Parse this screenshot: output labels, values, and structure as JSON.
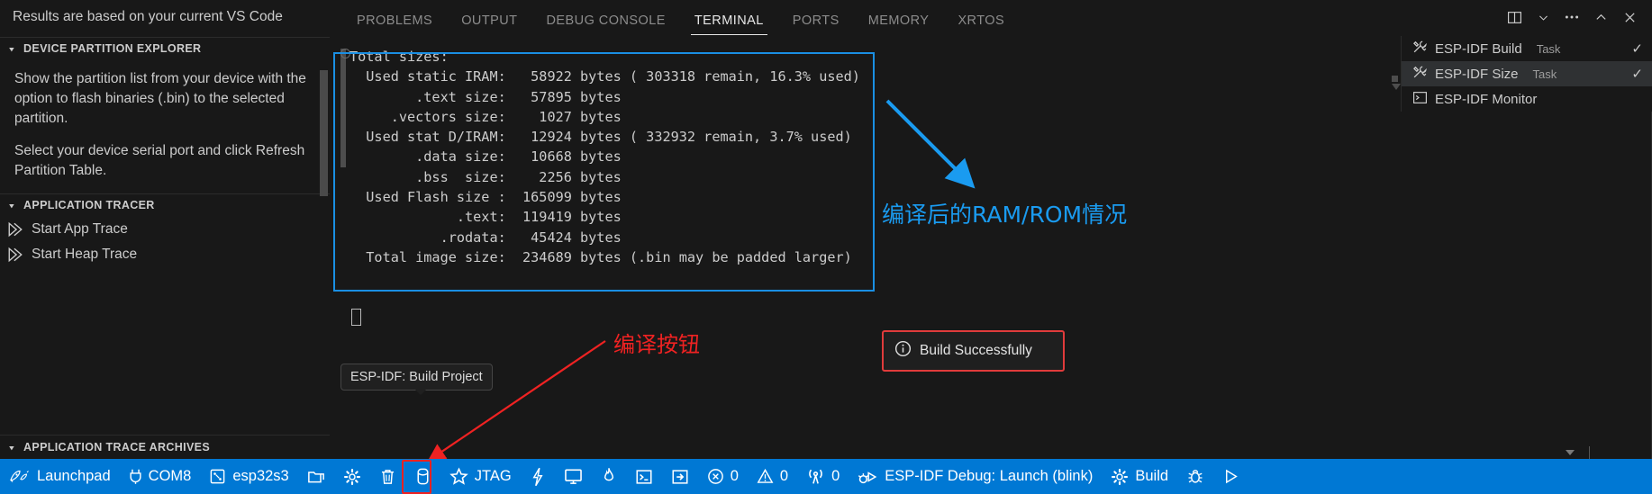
{
  "sidebar": {
    "note": "Results are based on your current VS Code",
    "sections": [
      {
        "title": "DEVICE PARTITION EXPLORER",
        "paragraphs": [
          "Show the partition list from your device with the option to flash binaries (.bin) to the selected partition.",
          "Select your device serial port and click Refresh Partition Table."
        ]
      },
      {
        "title": "APPLICATION TRACER",
        "items": [
          {
            "label": "Start App Trace",
            "icon": "double-arrow-icon"
          },
          {
            "label": "Start Heap Trace",
            "icon": "double-arrow-icon"
          }
        ]
      }
    ],
    "archives_title": "APPLICATION TRACE ARCHIVES"
  },
  "panel": {
    "tabs": [
      {
        "label": "PROBLEMS",
        "active": false
      },
      {
        "label": "OUTPUT",
        "active": false
      },
      {
        "label": "DEBUG CONSOLE",
        "active": false
      },
      {
        "label": "TERMINAL",
        "active": true
      },
      {
        "label": "PORTS",
        "active": false
      },
      {
        "label": "MEMORY",
        "active": false
      },
      {
        "label": "XRTOS",
        "active": false
      }
    ],
    "actions": [
      "split-editor-icon",
      "chevron-down-icon",
      "more-actions-icon",
      "chevron-up-icon",
      "close-icon"
    ]
  },
  "terminal": {
    "lines": [
      "Total sizes:",
      "  Used static IRAM:   58922 bytes ( 303318 remain, 16.3% used)",
      "        .text size:   57895 bytes",
      "     .vectors size:    1027 bytes",
      "  Used stat D/IRAM:   12924 bytes ( 332932 remain, 3.7% used)",
      "        .data size:   10668 bytes",
      "        .bss  size:    2256 bytes",
      "  Used Flash size :  165099 bytes",
      "             .text:  119419 bytes",
      "           .rodata:   45424 bytes",
      "  Total image size:  234689 bytes (.bin may be padded larger)"
    ]
  },
  "tasks": {
    "items": [
      {
        "name": "ESP-IDF Build",
        "type": "Task",
        "icon": "tools-icon",
        "check": "✓",
        "selected": false
      },
      {
        "name": "ESP-IDF Size",
        "type": "Task",
        "icon": "tools-icon",
        "check": "✓",
        "selected": true
      },
      {
        "name": "ESP-IDF Monitor",
        "type": "",
        "icon": "terminal-icon",
        "check": "",
        "selected": false
      }
    ]
  },
  "notification": {
    "text": "Build Successfully",
    "icon": "info-icon",
    "border_color": "#e03b3b"
  },
  "tooltip": {
    "text": "ESP-IDF: Build Project"
  },
  "annotations": {
    "blue_text": "编译后的RAM/ROM情况",
    "blue_color": "#1a9bf0",
    "red_text": "编译按钮",
    "red_color": "#ef2222"
  },
  "statusbar": {
    "items": [
      {
        "label": "Launchpad",
        "icon": "rocket-icon",
        "name": "status-launchpad"
      },
      {
        "label": "COM8",
        "icon": "plug-icon",
        "name": "status-serial-port"
      },
      {
        "label": "esp32s3",
        "icon": "chip-icon",
        "name": "status-target-chip"
      },
      {
        "label": "",
        "icon": "folder-open-icon",
        "name": "status-open-folder"
      },
      {
        "label": "",
        "icon": "gear-icon",
        "name": "status-sdkconfig"
      },
      {
        "label": "",
        "icon": "trash-icon",
        "name": "status-fullclean"
      },
      {
        "label": "",
        "icon": "build-cylinder-icon",
        "name": "status-build"
      },
      {
        "label": "JTAG",
        "icon": "star-icon",
        "name": "status-jtag-flash"
      },
      {
        "label": "",
        "icon": "zap-icon",
        "name": "status-flash"
      },
      {
        "label": "",
        "icon": "monitor-icon",
        "name": "status-monitor"
      },
      {
        "label": "",
        "icon": "flame-icon",
        "name": "status-build-flash-monitor"
      },
      {
        "label": "",
        "icon": "terminal-icon",
        "name": "status-open-terminal"
      },
      {
        "label": "",
        "icon": "arrow-in-box-icon",
        "name": "status-qemu"
      },
      {
        "label": "0",
        "icon": "error-icon",
        "name": "status-errors"
      },
      {
        "label": "0",
        "icon": "warning-icon",
        "name": "status-warnings"
      },
      {
        "label": "0",
        "icon": "radio-tower-icon",
        "name": "status-ports"
      },
      {
        "label": "ESP-IDF Debug: Launch (blink)",
        "icon": "debug-alt-icon",
        "name": "status-debug-launch"
      },
      {
        "label": "Build",
        "icon": "gear-icon",
        "name": "status-build-task"
      },
      {
        "label": "",
        "icon": "bug-icon",
        "name": "status-debug"
      },
      {
        "label": "",
        "icon": "play-icon",
        "name": "status-run"
      }
    ]
  },
  "colors": {
    "accent": "#0078d4",
    "panel_bg": "#181818",
    "editor_bg": "#1f1f1f",
    "highlight_box": "#1a8fe3",
    "alert_red": "#ef2222"
  }
}
